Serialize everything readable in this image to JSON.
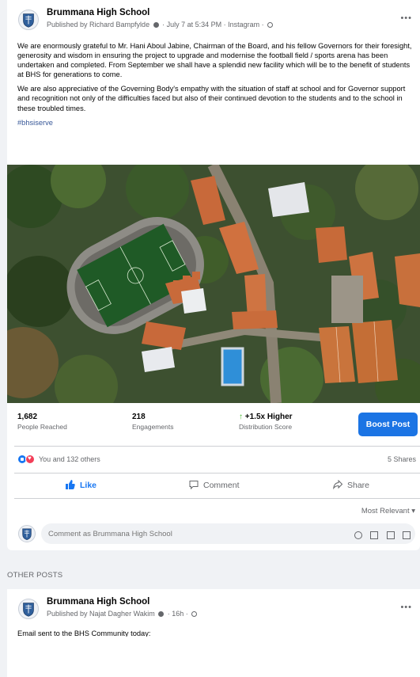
{
  "post": {
    "page_name": "Brummana High School",
    "meta": {
      "published_by": "Published by Richard Bampfylde",
      "time": "July 7 at 5:34 PM",
      "source": "Instagram"
    },
    "more_label": "•••",
    "paragraphs": [
      "We are enormously grateful to Mr. Hani Aboul Jabine, Chairman of the Board, and his fellow Governors for their foresight, generosity and wisdom in ensuring the project to upgrade and modernise the football field / sports arena has been undertaken and completed. From September we shall have a splendid new facility which will be to the benefit of students at BHS for generations to come.",
      "We are also appreciative of the Governing Body's empathy with the situation of staff at school and for Governor support and recognition not only of the difficulties faced but also of their continued devotion to the students and to the school in these troubled times."
    ],
    "hashtag": "#bhsiserve",
    "stats": {
      "reached_value": "1,682",
      "reached_label": "People Reached",
      "engagements_value": "218",
      "engagements_label": "Engagements",
      "distribution_value": "+1.5x Higher",
      "distribution_label": "Distribution Score",
      "arrow": "↑"
    },
    "boost_label": "Boost Post",
    "reactions_text": "You and 132 others",
    "shares_text": "5 Shares",
    "actions": {
      "like": "Like",
      "comment": "Comment",
      "share": "Share"
    },
    "sort_label": "Most Relevant ▾",
    "comment_placeholder": "Comment as Brummana High School"
  },
  "other_posts": {
    "section_label": "OTHER POSTS",
    "page_name": "Brummana High School",
    "meta": {
      "published_by": "Published by Najat Dagher Wakim",
      "time": "16h"
    },
    "more_label": "•••",
    "text": "Email sent to the BHS Community today:"
  },
  "colors": {
    "accent": "#1b74e4",
    "like_blue": "#1877f2",
    "love_red": "#f33e58",
    "green_arrow": "#42b72a"
  },
  "icons": [
    "school-crest-icon",
    "like-icon",
    "comment-icon",
    "share-icon",
    "globe-icon",
    "emoji-icon",
    "camera-icon",
    "gif-icon",
    "sticker-icon"
  ]
}
